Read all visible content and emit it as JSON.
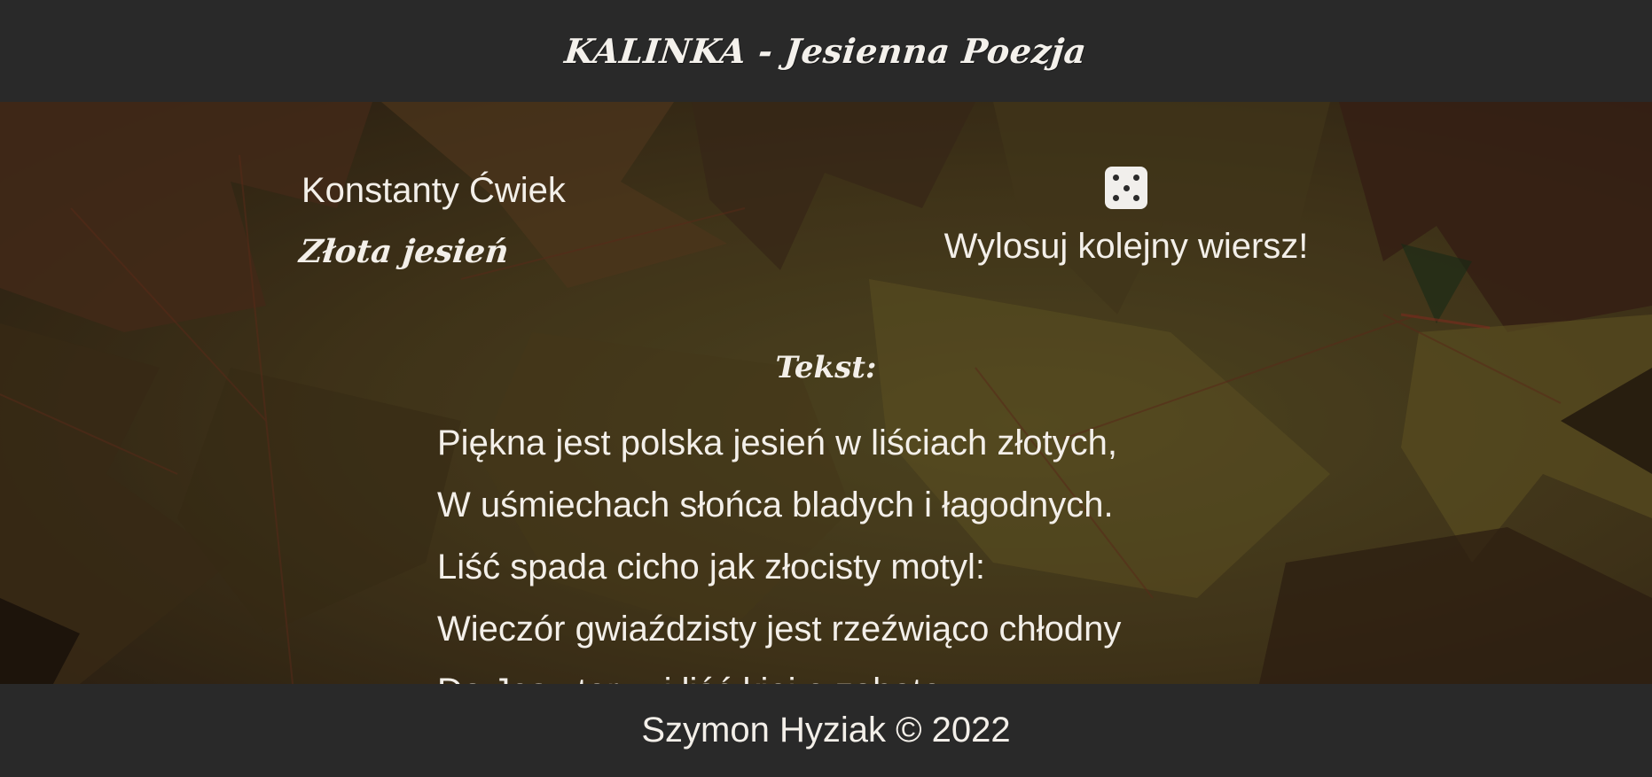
{
  "header": {
    "title": "KALINKA - Jesienna Poezja"
  },
  "poem": {
    "author": "Konstanty Ćwiek",
    "title": "Złota jesień",
    "text_heading": "Tekst:",
    "lines": [
      "Piękna jest polska jesień w liściach złotych,",
      "W uśmiechach słońca bladych i łagodnych.",
      "Liść spada cicho jak złocisty motyl:",
      "Wieczór gwiaździsty jest rzeźwiąco chłodny",
      "Do Jesu ter w i liść kiej e zobate"
    ]
  },
  "random_button": {
    "label": "Wylosuj kolejny wiersz!",
    "icon": "dice-icon"
  },
  "footer": {
    "copyright": "Szymon Hyziak © 2022"
  },
  "colors": {
    "bar_background": "#292929",
    "text": "#f3efe9"
  }
}
